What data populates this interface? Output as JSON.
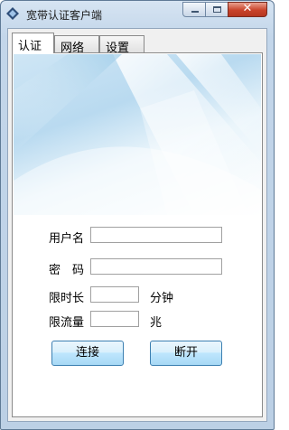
{
  "window": {
    "title": "宽带认证客户端",
    "close_glyph": "✕"
  },
  "tabs": [
    {
      "label": "认证"
    },
    {
      "label": "网络"
    },
    {
      "label": "设置"
    }
  ],
  "form": {
    "username_label": "用户名",
    "username_value": "",
    "password_label": "密　码",
    "password_value": "",
    "time_limit_label": "限时长",
    "time_limit_value": "",
    "time_limit_unit": "分钟",
    "traffic_limit_label": "限流量",
    "traffic_limit_value": "",
    "traffic_limit_unit": "兆"
  },
  "buttons": {
    "connect": "连接",
    "disconnect": "断开"
  }
}
